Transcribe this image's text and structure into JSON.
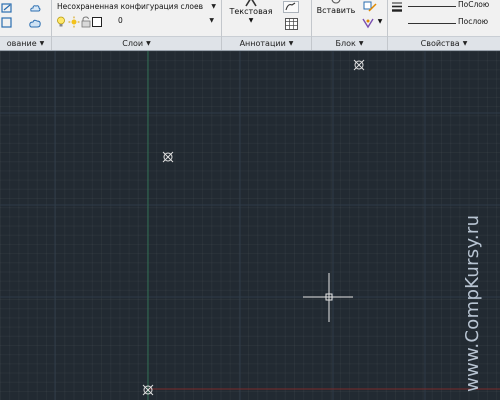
{
  "ribbon": {
    "left_panel": {
      "title": "ование"
    },
    "layers": {
      "title": "Слои",
      "layer_state_value": "Несохраненная конфигурация слоев",
      "current_layer_value": "0"
    },
    "annotations": {
      "title": "Аннотации",
      "text_label": "Текстовая"
    },
    "block": {
      "title": "Блок",
      "insert_label": "Вставить"
    },
    "properties": {
      "title": "Свойства",
      "linetype_value": "ПоСлою",
      "lineweight_value": "Послою"
    }
  },
  "watermark": "www.CompKursy.ru",
  "colors": {
    "ribbon_bg": "#f1f1f1",
    "panel_title_bg": "#dfe3e8",
    "canvas_bg": "#222a32",
    "grid_major": "#2e3b48",
    "y_axis": "#2f6e52",
    "x_axis": "#7a2a2a",
    "crosshair": "#e6e6e6",
    "marker": "#e0e0e0"
  },
  "icons": [
    "edit-icon",
    "cloud-icon",
    "lightbulb-icon",
    "sun-icon",
    "color-swatch-icon",
    "text-tool-icon",
    "polyline-icon",
    "table-icon",
    "insert-block-icon",
    "block-edit-icon",
    "attribute-icon",
    "lineweight-icon",
    "point-marker-icon",
    "crosshair-cursor-icon"
  ]
}
